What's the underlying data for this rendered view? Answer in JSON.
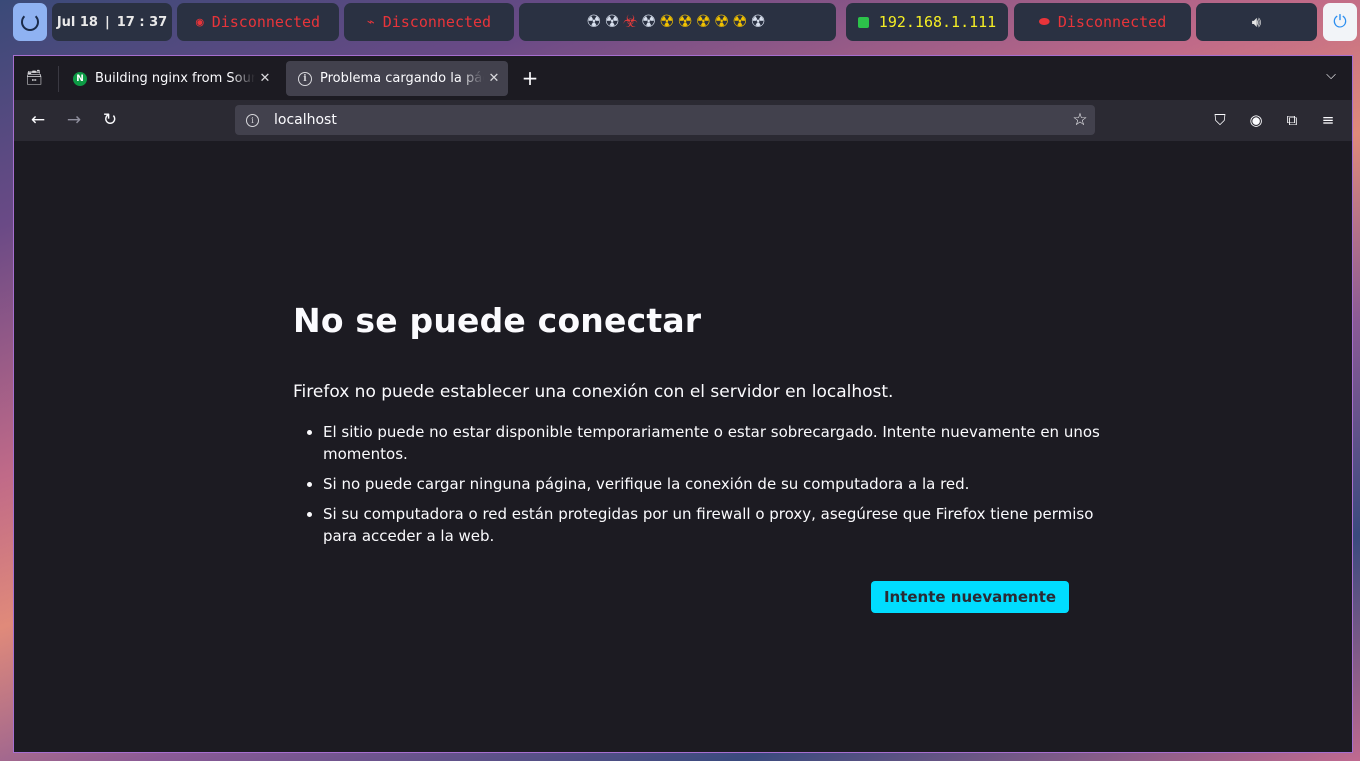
{
  "topbar": {
    "date": "Jul 18",
    "time": "17 : 37",
    "net_wifi_status": "Disconnected",
    "net_wired_status": "Disconnected",
    "workspaces": [
      "☢",
      "☢",
      "☣",
      "☢",
      "☢",
      "☢",
      "☢",
      "☢",
      "☢",
      "☢"
    ],
    "ip_address": "192.168.1.111",
    "vpn_status": "Disconnected",
    "colors": {
      "bar_bg": "#2a3142",
      "alert": "#e8343a",
      "ip": "#f5ee24",
      "active_ws": "#f2c200"
    }
  },
  "browser": {
    "tabs": [
      {
        "title": "Building nginx from Sources",
        "favicon": "nginx-icon",
        "active": false
      },
      {
        "title": "Problema cargando la página",
        "favicon": "info-icon",
        "active": true
      }
    ],
    "url": "localhost"
  },
  "page": {
    "title": "No se puede conectar",
    "lead": "Firefox no puede establecer una conexión con el servidor en localhost.",
    "bullets": [
      "El sitio puede no estar disponible temporariamente o estar sobrecargado. Intente nuevamente en unos momentos.",
      "Si no puede cargar ninguna página, verifique la conexión de su computadora a la red.",
      "Si su computadora o red están protegidas por un firewall o proxy, asegúrese que Firefox tiene permiso para acceder a la web."
    ],
    "retry_label": "Intente nuevamente",
    "colors": {
      "accent": "#00ddff",
      "bg": "#1c1b22"
    }
  }
}
